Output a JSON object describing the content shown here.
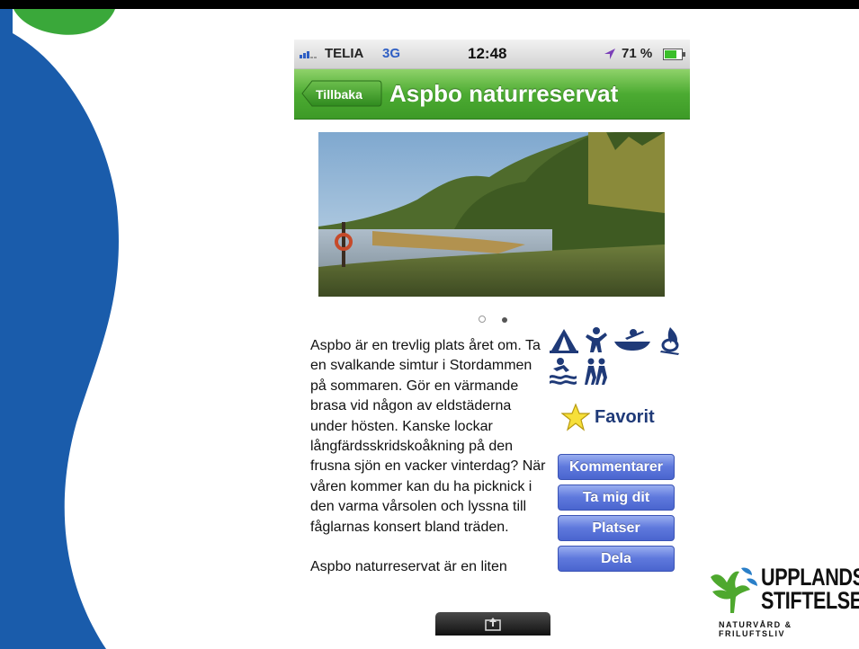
{
  "status_bar": {
    "carrier": "TELIA",
    "network": "3G",
    "time": "12:48",
    "battery": "71 %"
  },
  "nav": {
    "back_label": "Tillbaka",
    "title": "Aspbo naturreservat"
  },
  "gallery": {
    "pages": 2,
    "current_page": 2
  },
  "description": {
    "paragraphs": [
      "Aspbo är en trevlig plats året om. Ta en svalkande simtur i Stordammen på sommaren. Gör en värmande brasa vid någon av eldstäderna under hösten. Kanske lockar långfärdsskridskoåkning på den frusna sjön en vacker vinterdag? När våren kommer kan du ha picknick i den varma vårsolen och lyssna till fåglarnas konsert bland träden.",
      "Aspbo naturreservat är en liten"
    ]
  },
  "activity_icons": [
    "tent-icon",
    "child-play-icon",
    "canoe-icon",
    "campfire-icon",
    "swimming-icon",
    "hiking-icon"
  ],
  "favorite": {
    "label": "Favorit"
  },
  "actions": {
    "comments": "Kommentarer",
    "directions": "Ta mig dit",
    "places": "Platser",
    "share": "Dela"
  },
  "logo": {
    "line1": "UPPLANDS",
    "line2": "STIFTELSEN",
    "tagline": "NATURVÅRD & FRILUFTSLIV"
  },
  "colors": {
    "nav_green": "#4cab32",
    "button_blue": "#5f79dd",
    "decor_blue": "#1a5cab",
    "decor_green": "#3aa83a"
  }
}
